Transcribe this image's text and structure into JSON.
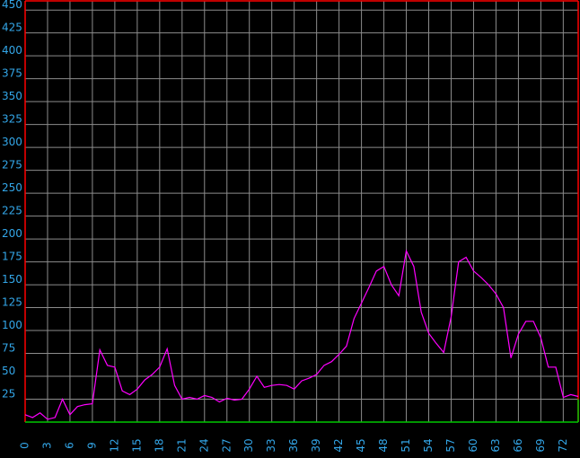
{
  "chart_data": {
    "type": "line",
    "title": "",
    "xlabel": "",
    "ylabel": "",
    "xlim": [
      0,
      74
    ],
    "ylim": [
      0,
      460
    ],
    "grid": true,
    "x_ticks": [
      0,
      3,
      6,
      9,
      12,
      15,
      18,
      21,
      24,
      27,
      30,
      33,
      36,
      39,
      42,
      45,
      48,
      51,
      54,
      57,
      60,
      63,
      66,
      69,
      72
    ],
    "y_ticks": [
      25,
      50,
      75,
      100,
      125,
      150,
      175,
      200,
      225,
      250,
      275,
      300,
      325,
      350,
      375,
      400,
      425,
      450
    ],
    "series": [
      {
        "x": [
          0,
          1,
          2,
          3,
          4,
          5,
          6,
          7,
          8,
          9,
          10,
          11,
          12,
          13,
          14,
          15,
          16,
          17,
          18,
          19,
          20,
          21,
          22,
          23,
          24,
          25,
          26,
          27,
          28,
          29,
          30,
          31,
          32,
          33,
          34,
          35,
          36,
          37,
          38,
          39,
          40,
          41,
          42,
          43,
          44,
          45,
          46,
          47,
          48,
          49,
          50,
          51,
          52,
          53,
          54,
          55,
          56,
          57,
          58,
          59,
          60,
          61,
          62,
          63,
          64,
          65,
          66,
          67,
          68,
          69,
          70,
          71,
          72,
          73,
          74
        ],
        "y": [
          8,
          5,
          10,
          3,
          5,
          25,
          8,
          17,
          19,
          20,
          79,
          62,
          60,
          34,
          30,
          36,
          46,
          52,
          60,
          80,
          40,
          25,
          27,
          25,
          29,
          27,
          22,
          26,
          24,
          25,
          36,
          50,
          38,
          40,
          41,
          40,
          36,
          45,
          48,
          52,
          62,
          66,
          74,
          83,
          113,
          130,
          147,
          165,
          170,
          150,
          138,
          187,
          170,
          120,
          97,
          86,
          76,
          115,
          175,
          180,
          165,
          158,
          150,
          140,
          125,
          70,
          96,
          110,
          110,
          92,
          60,
          60,
          27,
          30,
          28
        ]
      }
    ],
    "colors": {
      "background": "#000000",
      "grid": "#8c8c8c",
      "line": "#ff00ff",
      "tick_label": "#33a6e8",
      "baseline": "#00c800",
      "border": "#ff0000"
    }
  }
}
